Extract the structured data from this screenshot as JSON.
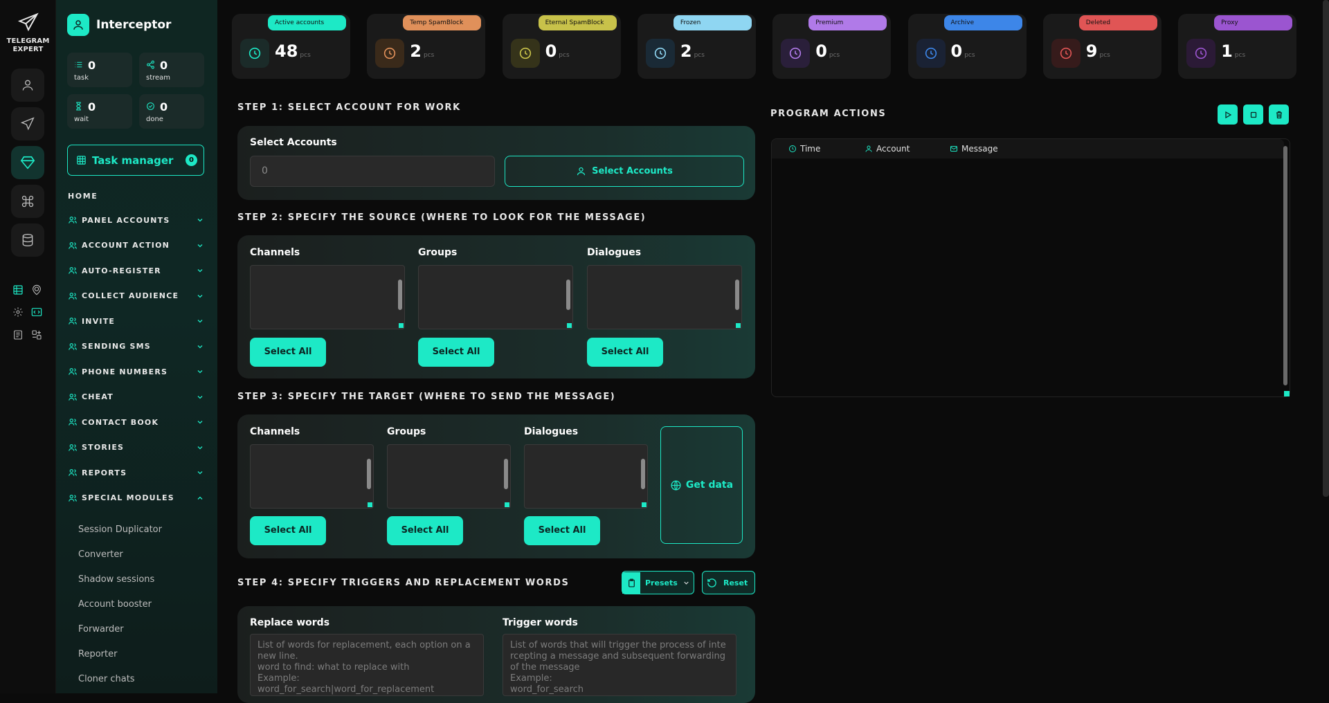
{
  "rail": {
    "brand": "TELEGRAM\nEXPERT",
    "buttons": [
      "user-icon",
      "send-icon",
      "diamond-icon",
      "command-icon",
      "database-icon"
    ],
    "mini_icons": [
      "table-icon",
      "map-pin-icon",
      "gear-icon",
      "code-icon",
      "list-icon",
      "grid-icon"
    ]
  },
  "app": {
    "title": "Interceptor"
  },
  "sidebar_stats": [
    {
      "value": "0",
      "label": "task"
    },
    {
      "value": "0",
      "label": "stream"
    },
    {
      "value": "0",
      "label": "wait"
    },
    {
      "value": "0",
      "label": "done"
    }
  ],
  "task_manager": {
    "label": "Task manager",
    "count": "0"
  },
  "nav": {
    "home": "HOME",
    "items": [
      {
        "label": "PANEL ACCOUNTS"
      },
      {
        "label": "ACCOUNT ACTION"
      },
      {
        "label": "AUTO-REGISTER"
      },
      {
        "label": "COLLECT AUDIENCE"
      },
      {
        "label": "INVITE"
      },
      {
        "label": "SENDING SMS"
      },
      {
        "label": "PHONE NUMBERS"
      },
      {
        "label": "CHEAT"
      },
      {
        "label": "CONTACT BOOK"
      },
      {
        "label": "STORIES"
      },
      {
        "label": "REPORTS"
      },
      {
        "label": "SPECIAL MODULES"
      }
    ],
    "sub_items": [
      "Session Duplicator",
      "Converter",
      "Shadow sessions",
      "Account booster",
      "Forwarder",
      "Reporter",
      "Cloner chats"
    ]
  },
  "status_cards": [
    {
      "pill": "Active accounts",
      "value": "48",
      "unit": "pcs",
      "color": "#1de9c6"
    },
    {
      "pill": "Temp SpamBlock",
      "value": "2",
      "unit": "pcs",
      "color": "#e0905a"
    },
    {
      "pill": "Eternal SpamBlock",
      "value": "0",
      "unit": "pcs",
      "color": "#c8c24a"
    },
    {
      "pill": "Frozen",
      "value": "2",
      "unit": "pcs",
      "color": "#8fd6f2"
    },
    {
      "pill": "Premium",
      "value": "0",
      "unit": "pcs",
      "color": "#b07ae8"
    },
    {
      "pill": "Archive",
      "value": "0",
      "unit": "pcs",
      "color": "#3d86e8"
    },
    {
      "pill": "Deleted",
      "value": "9",
      "unit": "pcs",
      "color": "#e05555"
    },
    {
      "pill": "Proxy",
      "value": "1",
      "unit": "pcs",
      "color": "#9b55d0"
    }
  ],
  "step1": {
    "title": "STEP 1: SELECT ACCOUNT FOR WORK",
    "label": "Select Accounts",
    "input_value": "0",
    "button": "Select Accounts"
  },
  "step2": {
    "title": "STEP 2: SPECIFY THE SOURCE (WHERE TO LOOK FOR THE MESSAGE)",
    "lists": [
      "Channels",
      "Groups",
      "Dialogues"
    ],
    "select_all": "Select All"
  },
  "step3": {
    "title": "STEP 3: SPECIFY THE TARGET (WHERE TO SEND THE MESSAGE)",
    "lists": [
      "Channels",
      "Groups",
      "Dialogues"
    ],
    "select_all": "Select All",
    "get_data": "Get data"
  },
  "step4": {
    "title": "STEP 4: SPECIFY TRIGGERS AND REPLACEMENT WORDS",
    "presets": "Presets",
    "reset": "Reset",
    "replace_label": "Replace words",
    "replace_placeholder": "List of words for replacement, each option on a new line.\nword to find: what to replace with\nExample:\nword_for_search|word_for_replacement",
    "trigger_label": "Trigger words",
    "trigger_placeholder": "List of words that will trigger the process of intercepting a message and subsequent forwarding of the message\nExample:\nword_for_search"
  },
  "program_actions": {
    "title": "PROGRAM ACTIONS",
    "columns": [
      "Time",
      "Account",
      "Message"
    ]
  },
  "accent": "#1de9c6"
}
